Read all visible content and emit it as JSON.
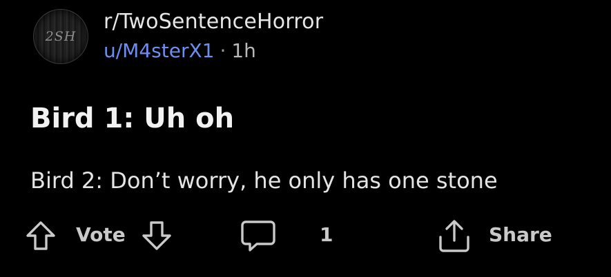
{
  "post": {
    "avatar": {
      "text": "2SH",
      "icon": "subreddit-avatar"
    },
    "subreddit": "r/TwoSentenceHorror",
    "author": "u/M4sterX1",
    "separator": "·",
    "age": "1h",
    "title": "Bird 1: Uh oh",
    "body": "Bird 2: Don’t worry, he only has one stone"
  },
  "actions": {
    "upvote_icon": "arrow-up-icon",
    "vote_label": "Vote",
    "downvote_icon": "arrow-down-icon",
    "comment_icon": "comment-bubble-icon",
    "comment_count": "1",
    "share_icon": "share-icon",
    "share_label": "Share"
  },
  "colors": {
    "background": "#000000",
    "text_primary": "#f2f2f2",
    "username": "#6f8ff0",
    "muted": "#9a9a9a",
    "icon": "#c9c9c9"
  }
}
